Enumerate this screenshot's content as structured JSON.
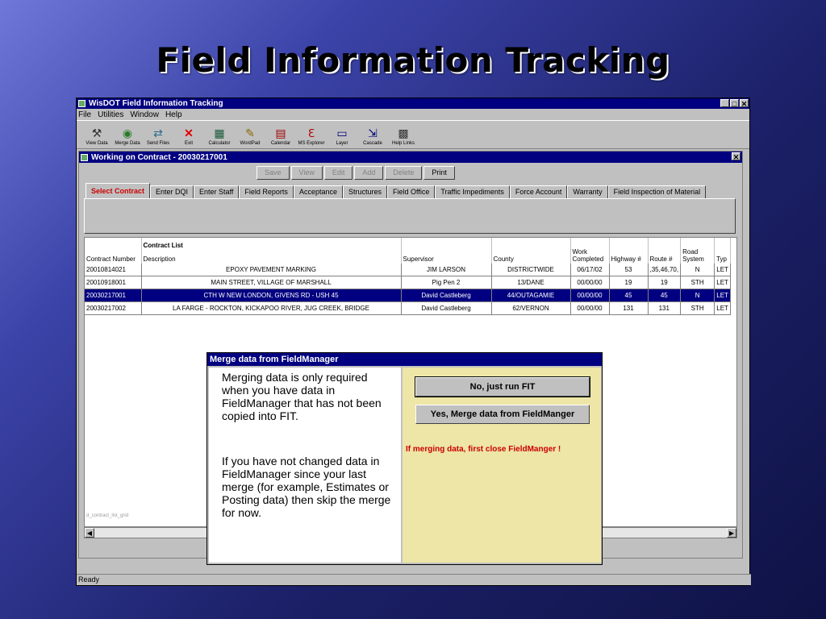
{
  "slide": {
    "title": "Field Information Tracking"
  },
  "app": {
    "title": "WisDOT Field Information Tracking",
    "window_buttons": [
      "_",
      "□",
      "✕"
    ],
    "menu": [
      "File",
      "Utilities",
      "Window",
      "Help"
    ],
    "toolbar": [
      {
        "icon": "⚒",
        "label": "View Data"
      },
      {
        "icon": "◉",
        "label": "Merge Data"
      },
      {
        "icon": "⇄",
        "label": "Send Files"
      },
      {
        "icon": "✕",
        "label": "Exit"
      },
      {
        "icon": "▦",
        "label": "Calculator"
      },
      {
        "icon": "✎",
        "label": "WordPad"
      },
      {
        "icon": "▤",
        "label": "Calendar"
      },
      {
        "icon": "ℇ",
        "label": "MS Explorer"
      },
      {
        "icon": "▭",
        "label": "Layer"
      },
      {
        "icon": "⇲",
        "label": "Cascade"
      },
      {
        "icon": "▩",
        "label": "Help Links"
      }
    ],
    "status": "Ready"
  },
  "child": {
    "title": "Working on Contract - 20030217001",
    "actions": [
      {
        "label": "Save",
        "enabled": false
      },
      {
        "label": "View",
        "enabled": false
      },
      {
        "label": "Edit",
        "enabled": false
      },
      {
        "label": "Add",
        "enabled": false
      },
      {
        "label": "Delete",
        "enabled": false
      },
      {
        "label": "Print",
        "enabled": true
      }
    ],
    "tabs": [
      "Select Contract",
      "Enter DQI",
      "Enter Staff",
      "Field Reports",
      "Acceptance",
      "Structures",
      "Field Office",
      "Traffic Impediments",
      "Force Account",
      "Warranty",
      "Field Inspection of Material"
    ],
    "active_tab": 0,
    "grid": {
      "caption": "Contract List",
      "headers": [
        "Contract Number",
        "Description",
        "Supervisor",
        "County",
        "Work Completed",
        "Highway #",
        "Route #",
        "Road System",
        "Typ"
      ],
      "rows": [
        [
          "20010814021",
          "EPOXY PAVEMENT MARKING",
          "JIM LARSON",
          "DISTRICTWIDE",
          "06/17/02",
          "53",
          ",35,46,70,",
          "N",
          "LET"
        ],
        [
          "20010918001",
          "MAIN STREET, VILLAGE OF MARSHALL",
          "Pig Pen 2",
          "13/DANE",
          "00/00/00",
          "19",
          "19",
          "STH",
          "LET"
        ],
        [
          "20030217001",
          "CTH W NEW LONDON, GIVENS RD - USH 45",
          "David Castleberg",
          "44/OUTAGAMIE",
          "00/00/00",
          "45",
          "45",
          "N",
          "LET"
        ],
        [
          "20030217002",
          "LA FARGE - ROCKTON, KICKAPOO RIVER, JUG CREEK, BRIDGE",
          "David Castleberg",
          "62/VERNON",
          "00/00/00",
          "131",
          "131",
          "STH",
          "LET"
        ]
      ],
      "selected_row": 2,
      "footer_label": "d_contract_list_grid"
    }
  },
  "dialog": {
    "title": "Merge data from FieldManager",
    "para1": "Merging data is only required when you have data in FieldManager that has not been copied into FIT.",
    "para2": "If you have not changed data in FieldManager since your last merge (for example, Estimates or Posting data) then skip the merge for now.",
    "btn_no": "No, just run FIT",
    "btn_yes": "Yes, Merge data from FieldManger",
    "warning": "If merging data, first close FieldManger !",
    "warning_color": "#cc0000",
    "panel_color": "#ede6a6"
  }
}
